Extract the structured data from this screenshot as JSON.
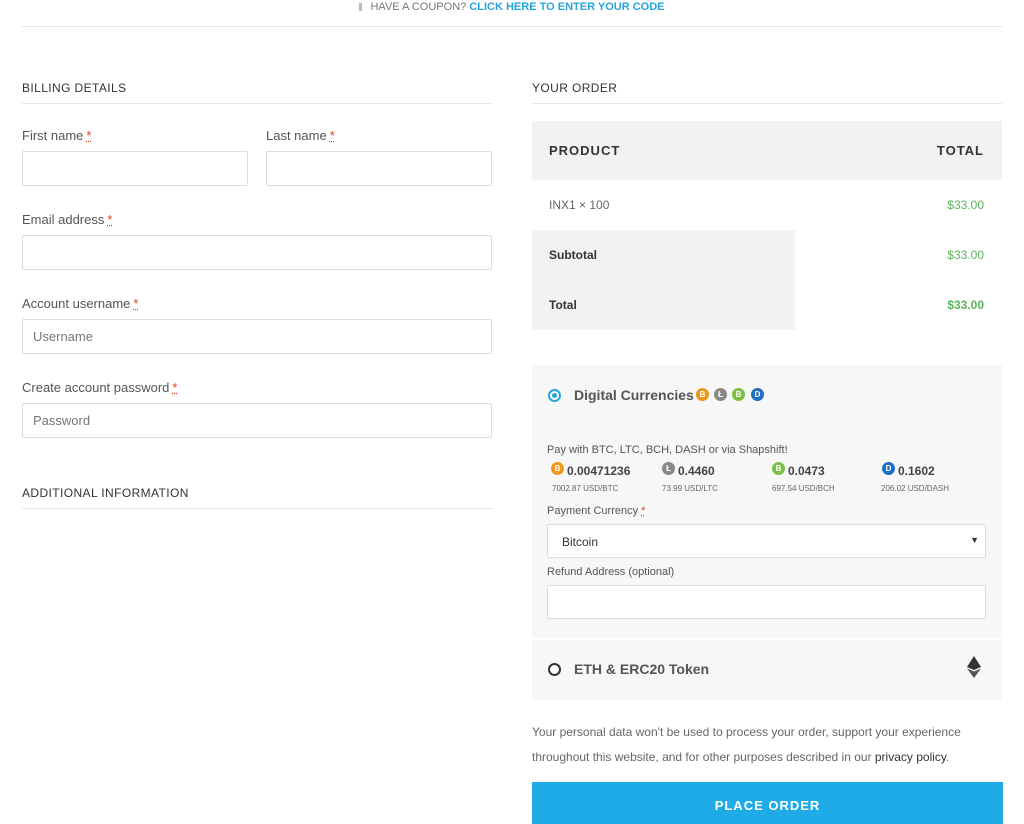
{
  "coupon": {
    "prompt": "HAVE A COUPON?",
    "link": "CLICK HERE TO ENTER YOUR CODE"
  },
  "billing": {
    "heading": "BILLING DETAILS",
    "first_name_label": "First name",
    "last_name_label": "Last name",
    "email_label": "Email address",
    "username_label": "Account username",
    "username_placeholder": "Username",
    "password_label": "Create account password",
    "password_placeholder": "Password",
    "required_mark": "*"
  },
  "additional": {
    "heading": "ADDITIONAL INFORMATION"
  },
  "order": {
    "heading": "YOUR ORDER",
    "col_product": "PRODUCT",
    "col_total": "TOTAL",
    "item_name": "INX1  × 100",
    "item_total": "$33.00",
    "subtotal_label": "Subtotal",
    "subtotal_value": "$33.00",
    "total_label": "Total",
    "total_value": "$33.00"
  },
  "payment": {
    "digital": {
      "title": "Digital Currencies",
      "selected": true,
      "description": "Pay with BTC, LTC, BCH, DASH or via Shapshift!",
      "rates": [
        {
          "icon": "bitcoin-icon",
          "amount": "0.00471236",
          "rate": "7002.87 USD/BTC"
        },
        {
          "icon": "litecoin-icon",
          "amount": "0.4460",
          "rate": "73.99 USD/LTC"
        },
        {
          "icon": "bitcoin-cash-icon",
          "amount": "0.0473",
          "rate": "697.54 USD/BCH"
        },
        {
          "icon": "dash-icon",
          "amount": "0.1602",
          "rate": "206.02 USD/DASH"
        }
      ],
      "currency_label": "Payment Currency",
      "currency_value": "Bitcoin",
      "refund_label": "Refund Address (optional)"
    },
    "eth": {
      "title": "ETH & ERC20 Token",
      "selected": false
    }
  },
  "privacy": {
    "text": "Your personal data won't be used to process your order, support your experience throughout this website, and for other purposes described in our ",
    "link": "privacy policy",
    "end": "."
  },
  "place_order_label": "PLACE ORDER",
  "colors": {
    "accent": "#1eabe8",
    "link": "#27a4dc",
    "price": "#5ab55a",
    "required": "#e2401c"
  }
}
